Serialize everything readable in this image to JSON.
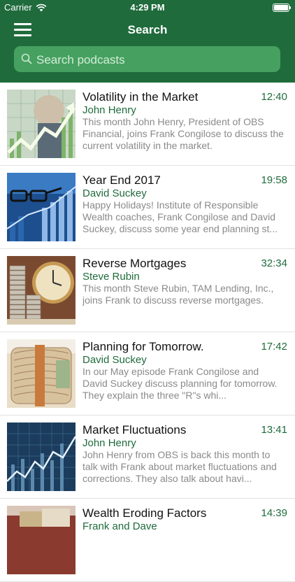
{
  "status_bar": {
    "carrier": "Carrier",
    "time": "4:29 PM"
  },
  "nav": {
    "title": "Search"
  },
  "search": {
    "placeholder": "Search podcasts",
    "value": ""
  },
  "colors": {
    "brand_green": "#1f6b3c",
    "search_bg": "#46a160"
  },
  "episodes": [
    {
      "title": "Volatility in the Market",
      "author": "John Henry",
      "duration": "12:40",
      "description": "This month John Henry, President of OBS Financial, joins Frank Congilose to discuss the current volatility in the market.",
      "thumb_icon": "market-chart-thumbnail"
    },
    {
      "title": "Year End 2017",
      "author": "David Suckey",
      "duration": "19:58",
      "description": "Happy Holidays! Institute of Responsible Wealth coaches, Frank Congilose and David Suckey, discuss some year end planning st...",
      "thumb_icon": "glasses-chart-thumbnail"
    },
    {
      "title": "Reverse Mortgages",
      "author": "Steve Rubin",
      "duration": "32:34",
      "description": "This month Steve Rubin, TAM Lending, Inc., joins Frank to discuss reverse mortgages.",
      "thumb_icon": "clock-coins-thumbnail"
    },
    {
      "title": "Planning for Tomorrow.",
      "author": "David Suckey",
      "duration": "17:42",
      "description": "In our May episode Frank Congilose and David Suckey discuss planning for tomorrow. They explain the three \"R\"s whi...",
      "thumb_icon": "money-roll-thumbnail"
    },
    {
      "title": "Market Fluctuations",
      "author": "John Henry",
      "duration": "13:41",
      "description": "John Henry from OBS is back this month to talk with Frank about market fluctuations and corrections. They also talk about havi...",
      "thumb_icon": "stock-graph-thumbnail"
    },
    {
      "title": "Wealth Eroding Factors",
      "author": "Frank and Dave",
      "duration": "14:39",
      "description": "",
      "thumb_icon": "money-thumbnail"
    }
  ]
}
